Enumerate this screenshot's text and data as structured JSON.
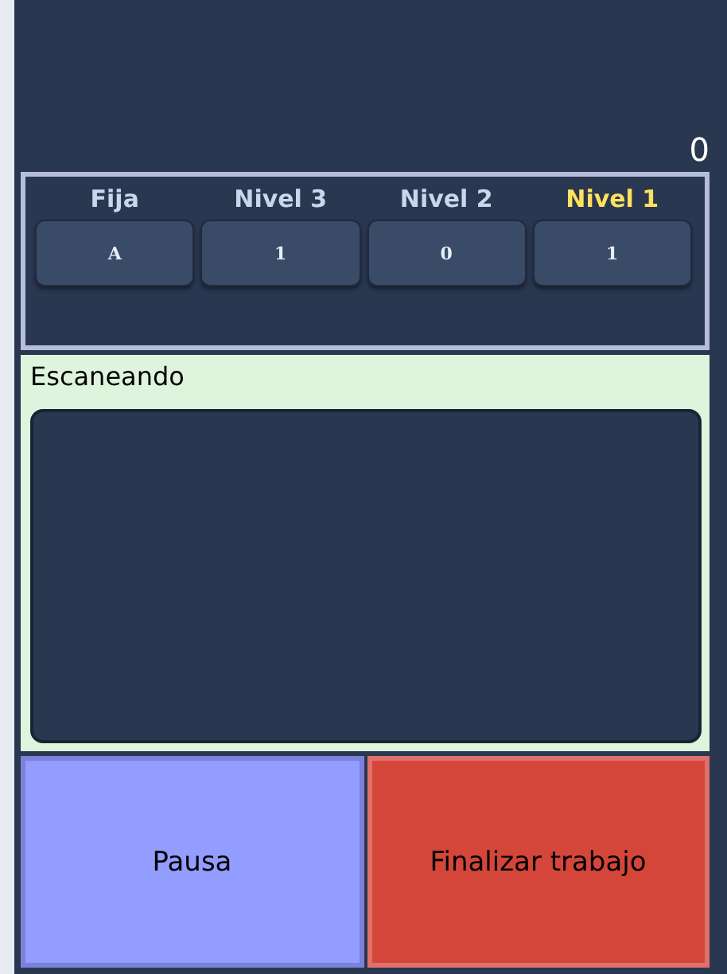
{
  "counter": "0",
  "levels": [
    {
      "label": "Fija",
      "value": "A",
      "selected": false
    },
    {
      "label": "Nivel 3",
      "value": "1",
      "selected": false
    },
    {
      "label": "Nivel 2",
      "value": "0",
      "selected": false
    },
    {
      "label": "Nivel 1",
      "value": "1",
      "selected": true
    }
  ],
  "scan_panel": {
    "title": "Escaneando"
  },
  "buttons": [
    {
      "label": "Pausa",
      "kind": "pause"
    },
    {
      "label": "Finalizar trabajo",
      "kind": "finish"
    }
  ]
}
